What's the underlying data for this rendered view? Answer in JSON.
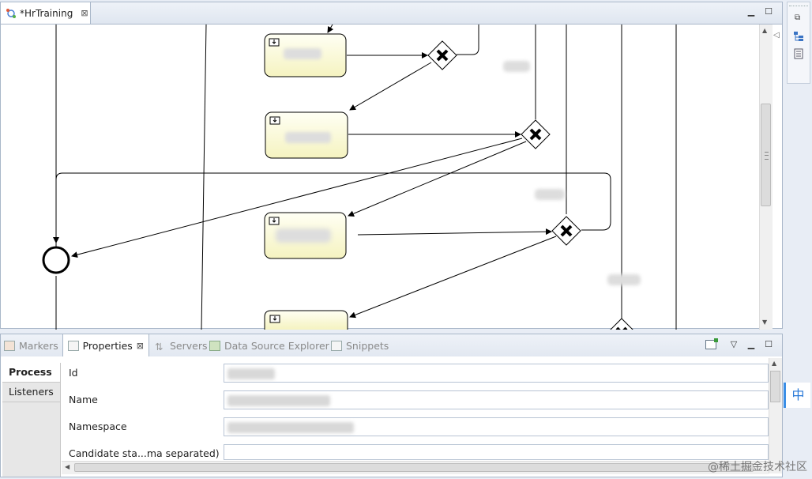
{
  "editor": {
    "tab_title": "*HrTraining",
    "tab_close": "⊠"
  },
  "panel": {
    "tabs": [
      "Markers",
      "Properties",
      "Servers",
      "Data Source Explorer",
      "Snippets"
    ],
    "active_tab_close": "⊠",
    "sidebar": [
      "Process",
      "Listeners"
    ],
    "fields": [
      "Id",
      "Name",
      "Namespace",
      "Candidate sta...ma separated)"
    ]
  },
  "ime": {
    "label": "中"
  },
  "watermark": "@稀土掘金技术社区"
}
